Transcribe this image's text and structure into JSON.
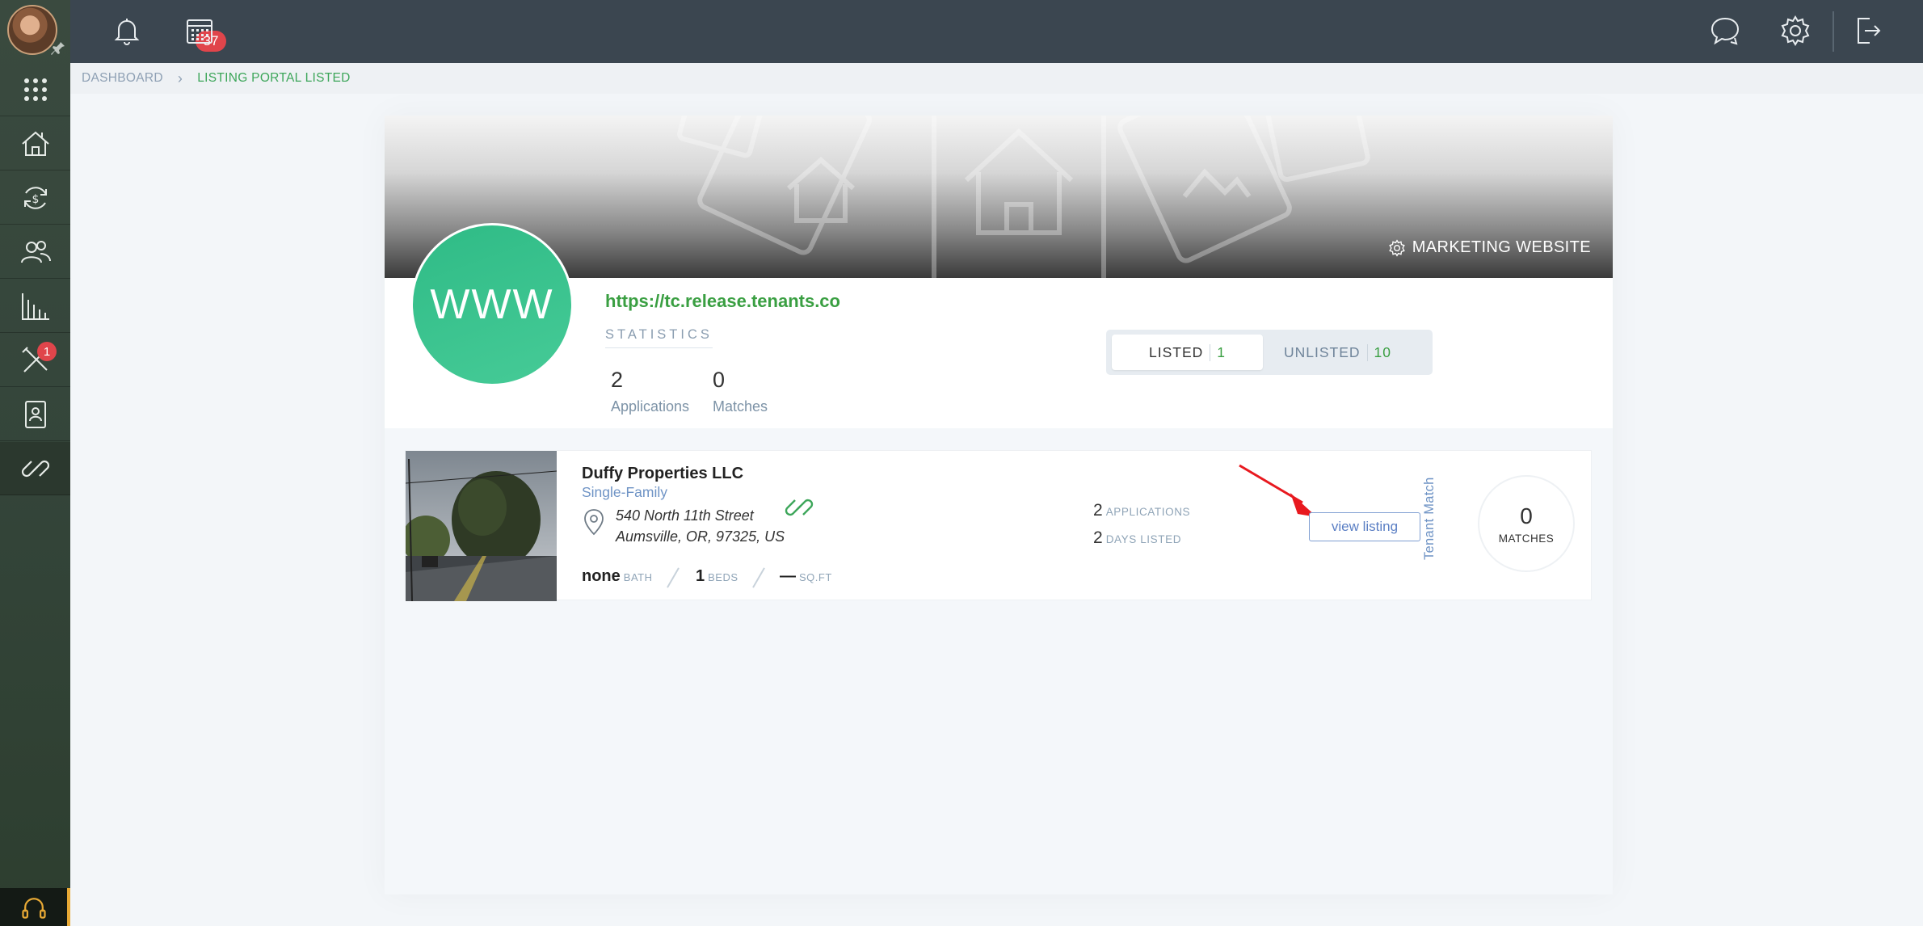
{
  "topbar": {
    "notification_count": "37"
  },
  "sidebar": {
    "tools_badge": "1"
  },
  "breadcrumb": {
    "dashboard": "DASHBOARD",
    "current": "LISTING PORTAL LISTED"
  },
  "header": {
    "marketing_label": "MARKETING WEBSITE",
    "logo_text": "WWW",
    "site_url": "https://tc.release.tenants.co",
    "stats_title": "STATISTICS",
    "applications_count": "2",
    "applications_label": "Applications",
    "matches_count": "0",
    "matches_label": "Matches"
  },
  "tabs": {
    "listed_label": "LISTED",
    "listed_count": "1",
    "unlisted_label": "UNLISTED",
    "unlisted_count": "10"
  },
  "listing": {
    "company": "Duffy Properties LLC",
    "type": "Single-Family",
    "address_line1": "540 North 11th Street",
    "address_line2": "Aumsville, OR, 97325, US",
    "bath_value": "none",
    "bath_label": "BATH",
    "beds_value": "1",
    "beds_label": "BEDS",
    "sqft_value": "—",
    "sqft_label": "SQ.FT",
    "applications_value": "2",
    "applications_label": "APPLICATIONS",
    "days_value": "2",
    "days_label": "DAYS LISTED",
    "view_button": "view listing",
    "tenant_match_label": "Tenant Match",
    "matches_value": "0",
    "matches_label": "MATCHES"
  },
  "colors": {
    "accent_green": "#3a9f42",
    "topbar": "#3b4650",
    "badge_red": "#e0454b",
    "link_blue": "#6e93c5"
  }
}
